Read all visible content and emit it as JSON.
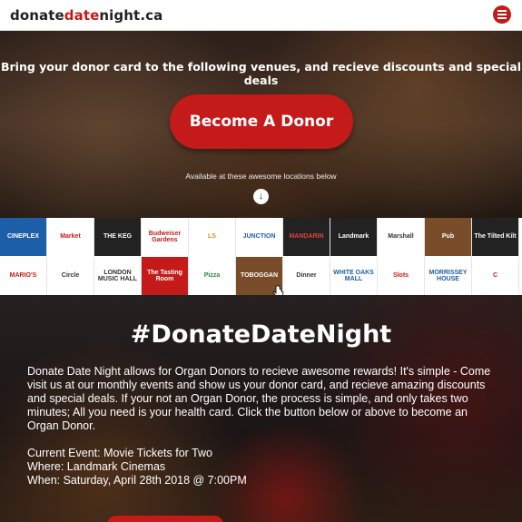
{
  "header": {
    "logo_part1": "donate",
    "logo_part2": "date",
    "logo_part3": "night.ca",
    "accent_color": "#c41a1a",
    "menu_icon": "hamburger-menu-icon"
  },
  "hero": {
    "tagline": "Bring your donor card to the following venues, and recieve discounts and special deals",
    "cta_label": "Become A Donor",
    "available_text": "Available at these awesome locations below",
    "down_icon": "arrow-down-circle-icon"
  },
  "venues": {
    "row1": [
      "CINEPLEX",
      "Market",
      "THE KEG",
      "Budweiser Gardens",
      "LS",
      "JUNCTION",
      "MANDARIN",
      "Landmark",
      "Marshall",
      "Pub",
      "The Tilted Kilt"
    ],
    "row2": [
      "MARIO'S",
      "Circle",
      "LONDON MUSIC HALL",
      "The Tasting Room",
      "Pizza",
      "TOBOGGAN",
      "Dinner",
      "WHITE OAKS MALL",
      "Slots",
      "MORRISSEY HOUSE",
      "C"
    ]
  },
  "main": {
    "hashtag": "#DonateDateNight",
    "description": "Donate Date Night allows for Organ Donors to recieve awesome rewards! It's simple - Come visit us at our monthly events and show us your donor card, and recieve amazing discounts and special deals. If your not an Organ Donor, the process is simple, and only takes two minutes; All you need is your health card. Click the button below or above to become an Organ Donor.",
    "current_event": "Current Event: Movie Tickets for Two",
    "where": "Where: Landmark Cinemas",
    "when": "When: Saturday, April 28th 2018 @ 7:00PM"
  }
}
